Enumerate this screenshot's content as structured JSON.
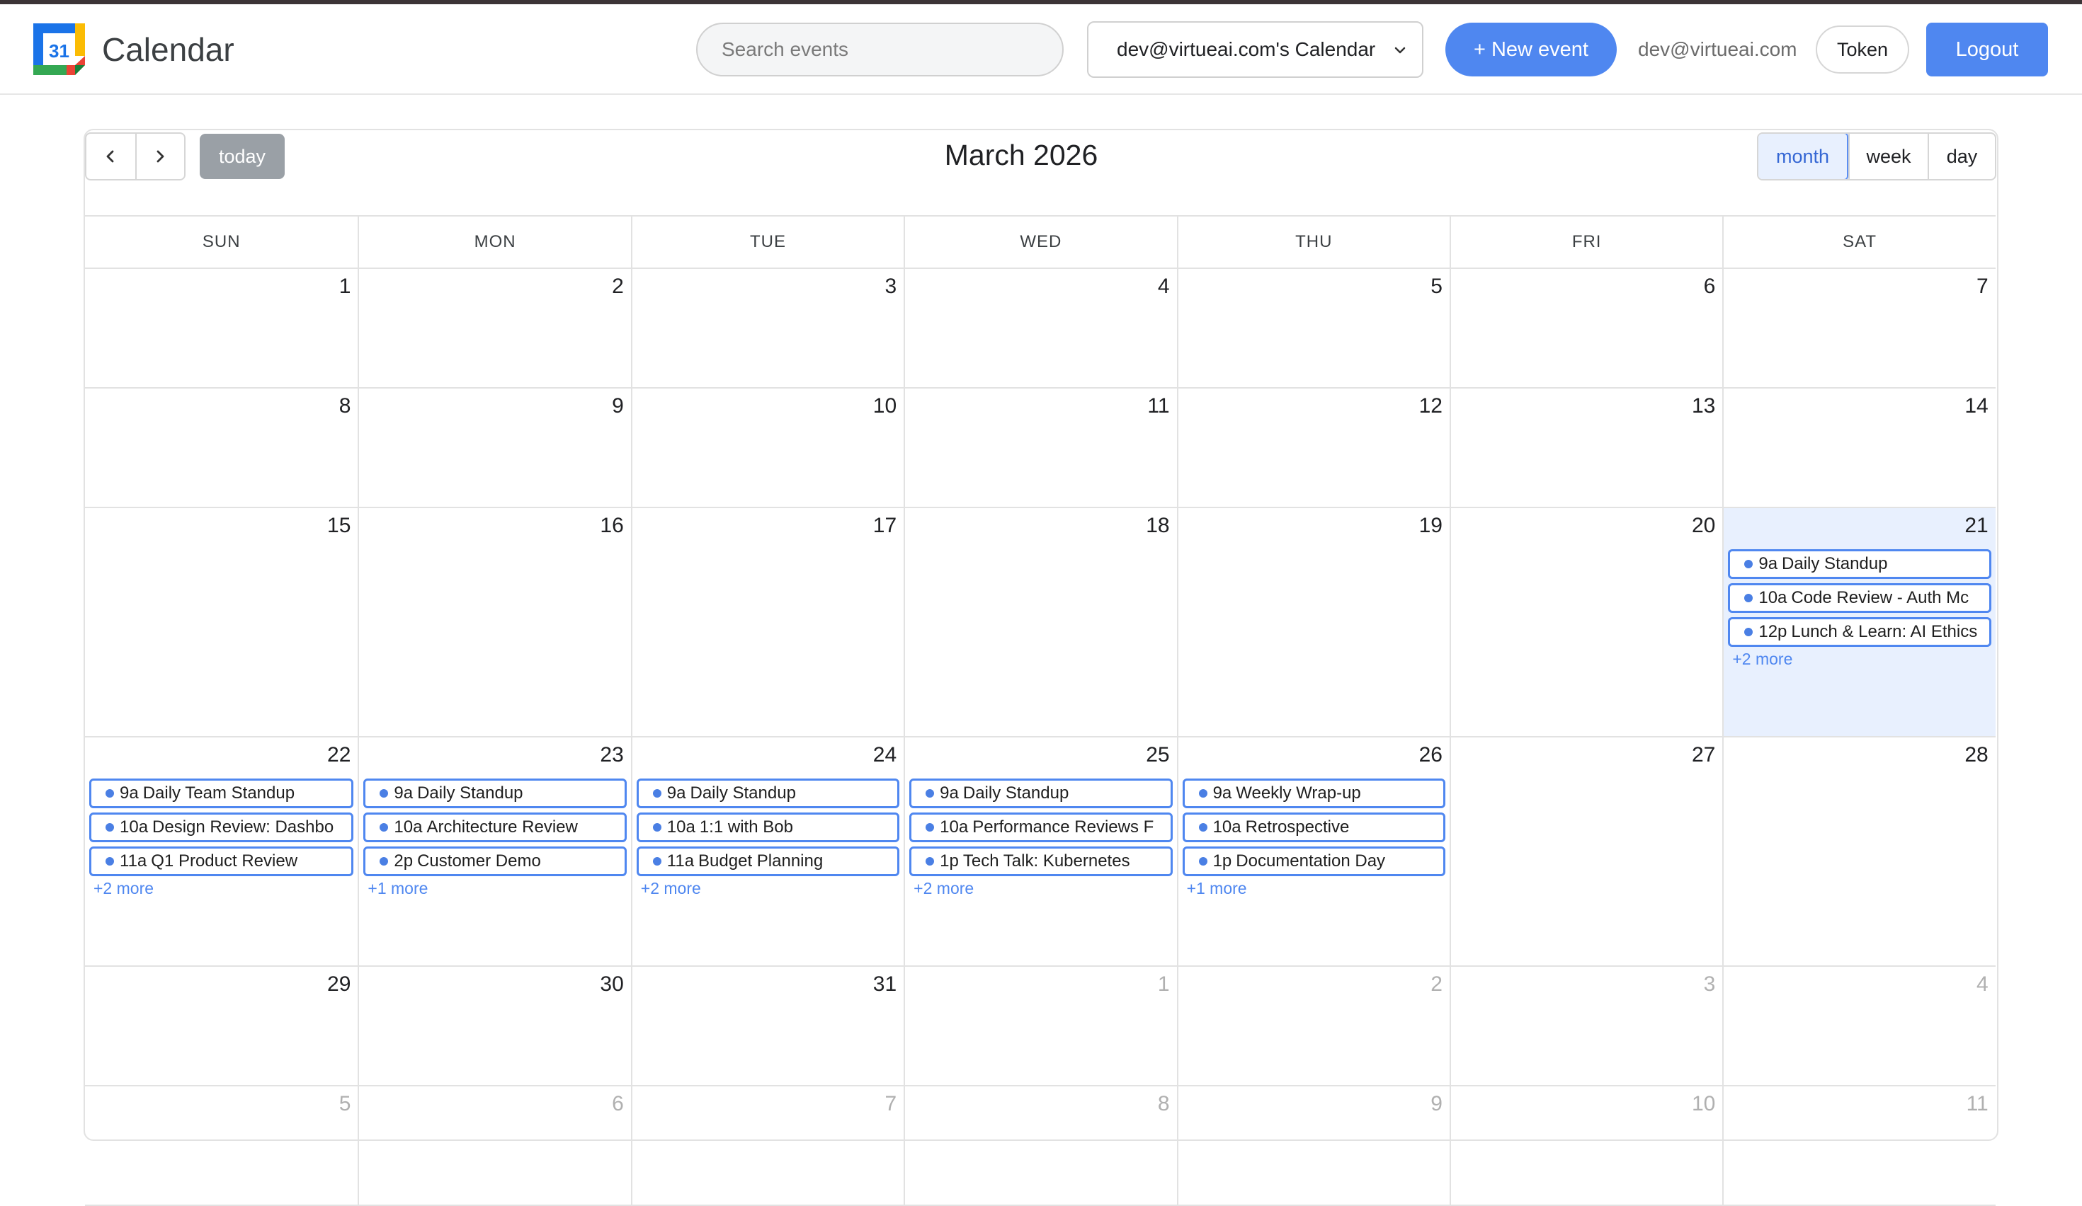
{
  "app": {
    "title": "Calendar",
    "logo_text": "31"
  },
  "header": {
    "search_placeholder": "Search events",
    "calendar_select": "dev@virtueai.com's Calendar",
    "new_event_label": "+ New event",
    "user_email": "dev@virtueai.com",
    "token_label": "Token",
    "logout_label": "Logout"
  },
  "toolbar": {
    "prev_icon": "chevron-left-icon",
    "next_icon": "chevron-right-icon",
    "today_label": "today",
    "month_title": "March 2026",
    "views": [
      {
        "label": "month",
        "active": true
      },
      {
        "label": "week",
        "active": false
      },
      {
        "label": "day",
        "active": false
      }
    ]
  },
  "colors": {
    "accent": "#4f87f0",
    "highlight_day": "#e8f0fe",
    "today_button": "#9aa0a6"
  },
  "days_of_week": [
    "SUN",
    "MON",
    "TUE",
    "WED",
    "THU",
    "FRI",
    "SAT"
  ],
  "weeks": [
    {
      "days": [
        {
          "num": "1"
        },
        {
          "num": "2"
        },
        {
          "num": "3"
        },
        {
          "num": "4"
        },
        {
          "num": "5"
        },
        {
          "num": "6"
        },
        {
          "num": "7"
        }
      ]
    },
    {
      "days": [
        {
          "num": "8"
        },
        {
          "num": "9"
        },
        {
          "num": "10"
        },
        {
          "num": "11"
        },
        {
          "num": "12"
        },
        {
          "num": "13"
        },
        {
          "num": "14"
        }
      ]
    },
    {
      "days": [
        {
          "num": "15"
        },
        {
          "num": "16"
        },
        {
          "num": "17"
        },
        {
          "num": "18"
        },
        {
          "num": "19"
        },
        {
          "num": "20"
        },
        {
          "num": "21",
          "highlight": true,
          "more": "+2 more",
          "events": [
            {
              "time": "9a",
              "title": "Daily Standup"
            },
            {
              "time": "10a",
              "title": "Code Review - Auth Mc"
            },
            {
              "time": "12p",
              "title": "Lunch & Learn: AI Ethics"
            }
          ]
        }
      ]
    },
    {
      "days": [
        {
          "num": "22",
          "more": "+2 more",
          "events": [
            {
              "time": "9a",
              "title": "Daily Team Standup"
            },
            {
              "time": "10a",
              "title": "Design Review: Dashbo"
            },
            {
              "time": "11a",
              "title": "Q1 Product Review"
            }
          ]
        },
        {
          "num": "23",
          "more": "+1 more",
          "events": [
            {
              "time": "9a",
              "title": "Daily Standup"
            },
            {
              "time": "10a",
              "title": "Architecture Review"
            },
            {
              "time": "2p",
              "title": "Customer Demo"
            }
          ]
        },
        {
          "num": "24",
          "more": "+2 more",
          "events": [
            {
              "time": "9a",
              "title": "Daily Standup"
            },
            {
              "time": "10a",
              "title": "1:1 with Bob"
            },
            {
              "time": "11a",
              "title": "Budget Planning"
            }
          ]
        },
        {
          "num": "25",
          "more": "+2 more",
          "events": [
            {
              "time": "9a",
              "title": "Daily Standup"
            },
            {
              "time": "10a",
              "title": "Performance Reviews F"
            },
            {
              "time": "1p",
              "title": "Tech Talk: Kubernetes"
            }
          ]
        },
        {
          "num": "26",
          "more": "+1 more",
          "events": [
            {
              "time": "9a",
              "title": "Weekly Wrap-up"
            },
            {
              "time": "10a",
              "title": "Retrospective"
            },
            {
              "time": "1p",
              "title": "Documentation Day"
            }
          ]
        },
        {
          "num": "27"
        },
        {
          "num": "28"
        }
      ]
    },
    {
      "days": [
        {
          "num": "29"
        },
        {
          "num": "30"
        },
        {
          "num": "31"
        },
        {
          "num": "1",
          "other": true
        },
        {
          "num": "2",
          "other": true
        },
        {
          "num": "3",
          "other": true
        },
        {
          "num": "4",
          "other": true
        }
      ]
    },
    {
      "days": [
        {
          "num": "5",
          "other": true
        },
        {
          "num": "6",
          "other": true
        },
        {
          "num": "7",
          "other": true
        },
        {
          "num": "8",
          "other": true
        },
        {
          "num": "9",
          "other": true
        },
        {
          "num": "10",
          "other": true
        },
        {
          "num": "11",
          "other": true
        }
      ]
    }
  ]
}
